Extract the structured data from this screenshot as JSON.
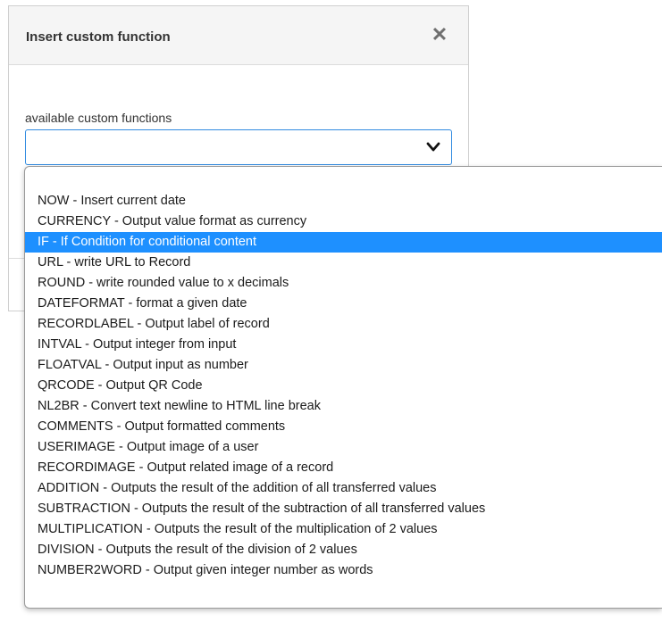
{
  "dialog": {
    "title": "Insert custom function",
    "close_glyph": "✕"
  },
  "field": {
    "label": "available custom functions",
    "selected_value": ""
  },
  "dropdown": {
    "options": [
      "NOW - Insert current date",
      "CURRENCY - Output value format as currency",
      "IF - If Condition for conditional content",
      "URL - write URL to Record",
      "ROUND - write rounded value to x decimals",
      "DATEFORMAT - format a given date",
      "RECORDLABEL - Output label of record",
      "INTVAL - Output integer from input",
      "FLOATVAL - Output input as number",
      "QRCODE - Output QR Code",
      "NL2BR - Convert text newline to HTML line break",
      "COMMENTS - Output formatted comments",
      "USERIMAGE - Output image of a user",
      "RECORDIMAGE - Output related image of a record",
      "ADDITION - Outputs the result of the addition of all transferred values",
      "SUBTRACTION - Outputs the result of the subtraction of all transferred values",
      "MULTIPLICATION - Outputs the result of the multiplication of 2 values",
      "DIVISION - Outputs the result of the division of 2 values",
      "NUMBER2WORD - Output given integer number as words"
    ],
    "highlighted_index": 2
  },
  "colors": {
    "highlight": "#1e90ff",
    "select_border": "#2f8ae0"
  }
}
